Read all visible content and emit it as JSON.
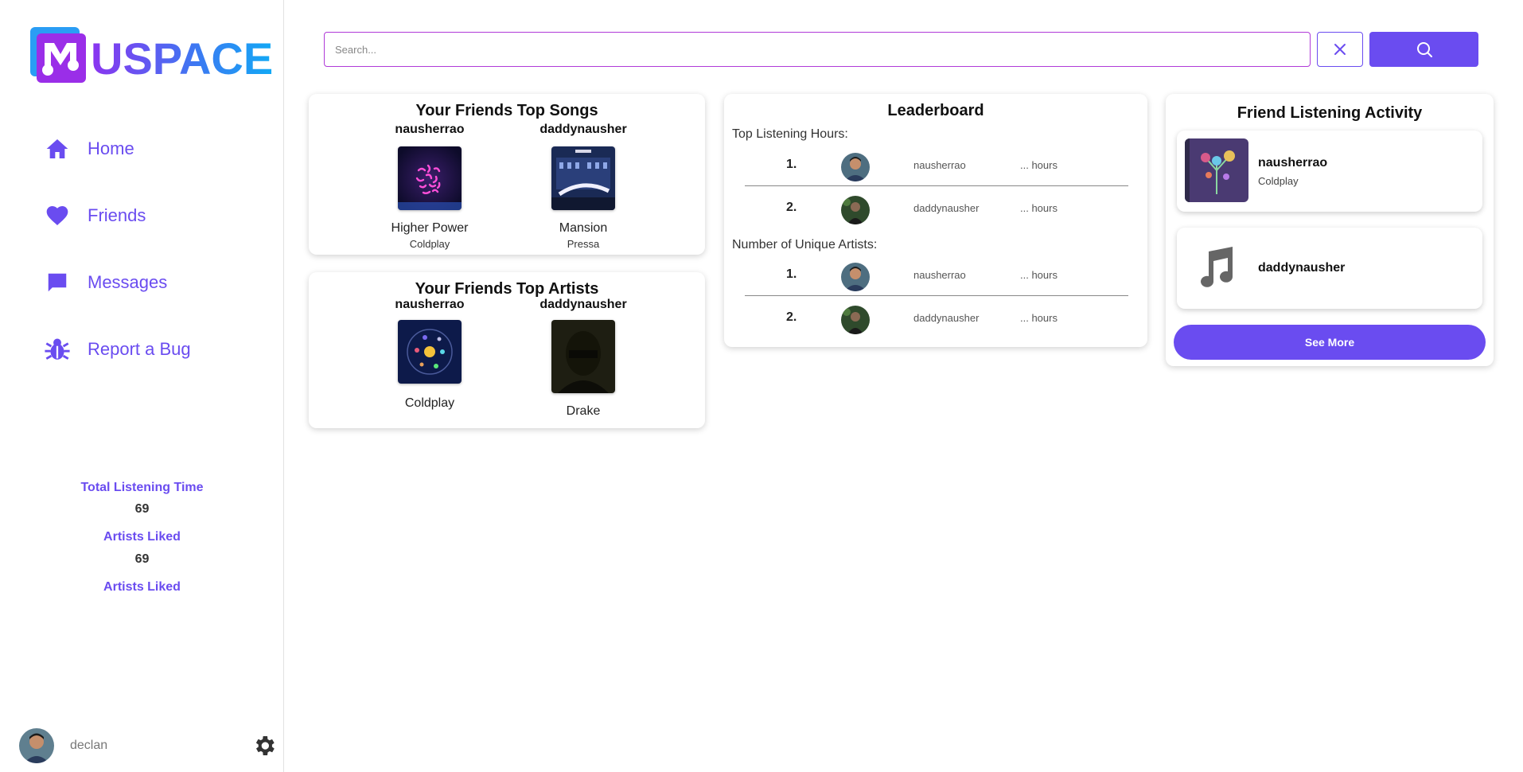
{
  "app": {
    "logo_text": "USPACE",
    "accent_color": "#6a4cf0"
  },
  "sidebar": {
    "items": [
      {
        "label": "Home",
        "icon": "home-icon"
      },
      {
        "label": "Friends",
        "icon": "heart-icon"
      },
      {
        "label": "Messages",
        "icon": "message-icon"
      },
      {
        "label": "Report a Bug",
        "icon": "bug-icon"
      }
    ],
    "stats": [
      {
        "label": "Total Listening Time",
        "value": "69"
      },
      {
        "label": "Artists Liked",
        "value": "69"
      },
      {
        "label": "Artists Liked",
        "value": ""
      }
    ],
    "user": {
      "name": "declan",
      "settings_icon": "gear-icon"
    }
  },
  "search": {
    "placeholder": "Search...",
    "clear_icon": "close-icon",
    "search_icon": "search-icon"
  },
  "top_songs": {
    "title": "Your Friends Top Songs",
    "entries": [
      {
        "friend": "nausherrao",
        "song": "Higher Power",
        "artist": "Coldplay"
      },
      {
        "friend": "daddynausher",
        "song": "Mansion",
        "artist": "Pressa"
      }
    ]
  },
  "top_artists": {
    "title": "Your Friends Top Artists",
    "entries": [
      {
        "friend": "nausherrao",
        "artist": "Coldplay"
      },
      {
        "friend": "daddynausher",
        "artist": "Drake"
      }
    ]
  },
  "leaderboard": {
    "title": "Leaderboard",
    "sections": [
      {
        "label": "Top Listening Hours:",
        "rows": [
          {
            "rank": "1.",
            "name": "nausherrao",
            "value": "... hours"
          },
          {
            "rank": "2.",
            "name": "daddynausher",
            "value": "... hours"
          }
        ]
      },
      {
        "label": "Number of Unique Artists:",
        "rows": [
          {
            "rank": "1.",
            "name": "nausherrao",
            "value": "... hours"
          },
          {
            "rank": "2.",
            "name": "daddynausher",
            "value": "... hours"
          }
        ]
      }
    ]
  },
  "activity": {
    "title": "Friend Listening Activity",
    "entries": [
      {
        "name": "nausherrao",
        "sub": "Coldplay"
      },
      {
        "name": "daddynausher",
        "sub": ""
      }
    ],
    "see_more": "See More"
  }
}
